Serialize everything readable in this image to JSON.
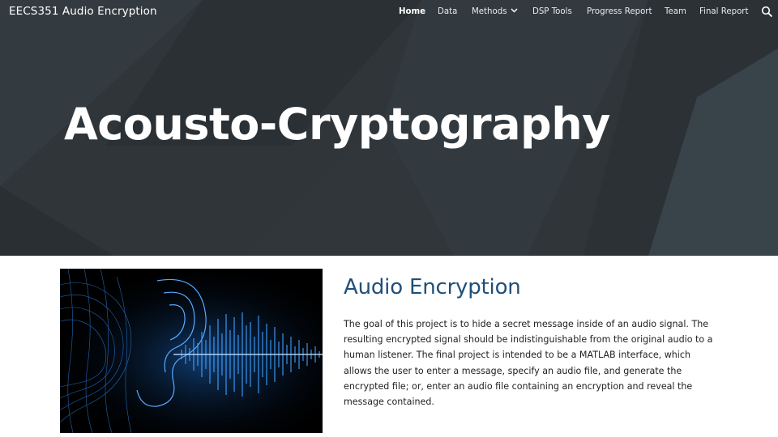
{
  "site": {
    "title": "EECS351 Audio Encryption"
  },
  "nav": {
    "items": [
      {
        "label": "Home",
        "active": true
      },
      {
        "label": "Data"
      },
      {
        "label": "Methods",
        "has_dropdown": true
      },
      {
        "label": "DSP Tools"
      },
      {
        "label": "Progress Report"
      },
      {
        "label": "Team"
      },
      {
        "label": "Final Report"
      }
    ],
    "search_icon": "search-icon"
  },
  "hero": {
    "title": "Acousto-Cryptography"
  },
  "section": {
    "heading": "Audio Encryption",
    "body": "The goal of this project is to hide a secret message inside of an audio signal. The resulting encrypted signal should be indistinguishable from the original audio to a human listener. The final project is intended to be a MATLAB interface, which allows the user to enter a message, specify an audio file, and generate the encrypted file; or, enter an audio file containing an encryption and reveal the message contained."
  },
  "colors": {
    "hero_bg": "#2e3438",
    "heading": "#1f4f7a",
    "image_accent": "#1e90ff"
  }
}
